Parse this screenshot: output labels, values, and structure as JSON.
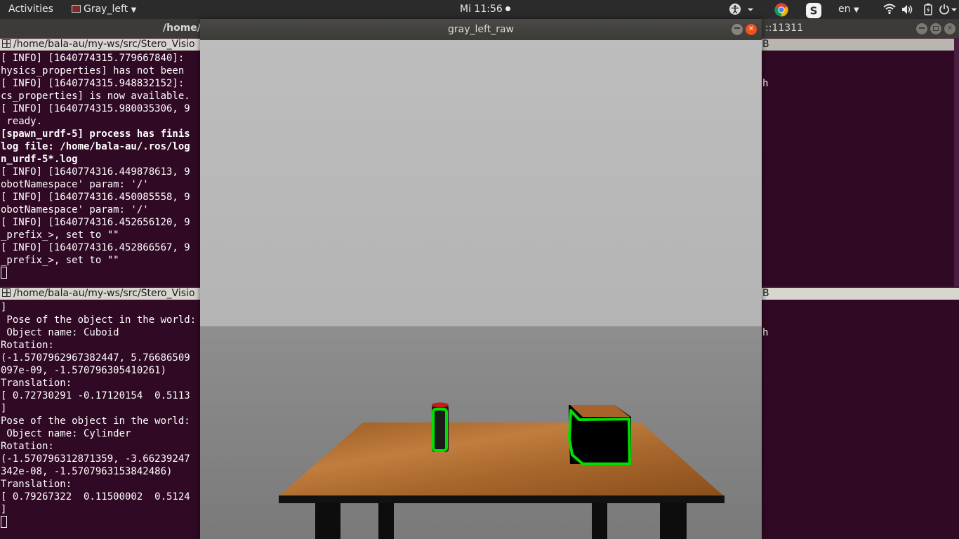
{
  "topbar": {
    "activities": "Activities",
    "app_menu": "Gray_left",
    "clock": "Mi 11:56",
    "lang": "en"
  },
  "background_window": {
    "title_left": "/home/",
    "title_right": "::11311"
  },
  "terminal_top": {
    "path": "/home/bala-au/my-ws/src/Stero_Visio",
    "lines": [
      {
        "text": "[ INFO] [1640774315.779667840]:",
        "bold": false
      },
      {
        "text": "hysics_properties] has not been",
        "bold": false
      },
      {
        "text": "[ INFO] [1640774315.948832152]:",
        "bold": false
      },
      {
        "text": "cs_properties] is now available.",
        "bold": false
      },
      {
        "text": "[ INFO] [1640774315.980035306, 9",
        "bold": false
      },
      {
        "text": " ready.",
        "bold": false
      },
      {
        "text": "[spawn_urdf-5] process has finis",
        "bold": true
      },
      {
        "text": "log file: /home/bala-au/.ros/log",
        "bold": true
      },
      {
        "text": "n_urdf-5*.log",
        "bold": true
      },
      {
        "text": "[ INFO] [1640774316.449878613, 9",
        "bold": false
      },
      {
        "text": "obotNamespace' param: '/'",
        "bold": false
      },
      {
        "text": "[ INFO] [1640774316.450085558, 9",
        "bold": false
      },
      {
        "text": "obotNamespace' param: '/'",
        "bold": false
      },
      {
        "text": "[ INFO] [1640774316.452656120, 9",
        "bold": false
      },
      {
        "text": "_prefix_>, set to \"\"",
        "bold": false
      },
      {
        "text": "[ INFO] [1640774316.452866567, 9",
        "bold": false
      },
      {
        "text": "_prefix_>, set to \"\"",
        "bold": false
      }
    ]
  },
  "terminal_bottom": {
    "path": "/home/bala-au/my-ws/src/Stero_Visio",
    "lines": [
      {
        "text": "]",
        "bold": false
      },
      {
        "text": " Pose of the object in the world:",
        "bold": false
      },
      {
        "text": " Object name: Cuboid",
        "bold": false
      },
      {
        "text": "Rotation:",
        "bold": false
      },
      {
        "text": "(-1.5707962967382447, 5.76686509",
        "bold": false
      },
      {
        "text": "097e-09, -1.570796305410261)",
        "bold": false
      },
      {
        "text": "Translation:",
        "bold": false
      },
      {
        "text": "[ 0.72730291 -0.17120154  0.5113",
        "bold": false
      },
      {
        "text": "]",
        "bold": false
      },
      {
        "text": "Pose of the object in the world:",
        "bold": false
      },
      {
        "text": " Object name: Cylinder",
        "bold": false
      },
      {
        "text": "Rotation:",
        "bold": false
      },
      {
        "text": "(-1.570796312871359, -3.66239247",
        "bold": false
      },
      {
        "text": "342e-08, -1.5707963153842486)",
        "bold": false
      },
      {
        "text": "Translation:",
        "bold": false
      },
      {
        "text": "[ 0.79267322  0.11500002  0.5124",
        "bold": false
      },
      {
        "text": "]",
        "bold": false
      }
    ]
  },
  "right_terminals": {
    "top_header": "B",
    "top_text": "h",
    "bottom_header": "B",
    "bottom_text": "h"
  },
  "viewer": {
    "title": "gray_left_raw"
  },
  "colors": {
    "detection_outline": "#00e000",
    "terminal_bg": "#300a24",
    "cylinder_cap": "#cc1a1a"
  }
}
